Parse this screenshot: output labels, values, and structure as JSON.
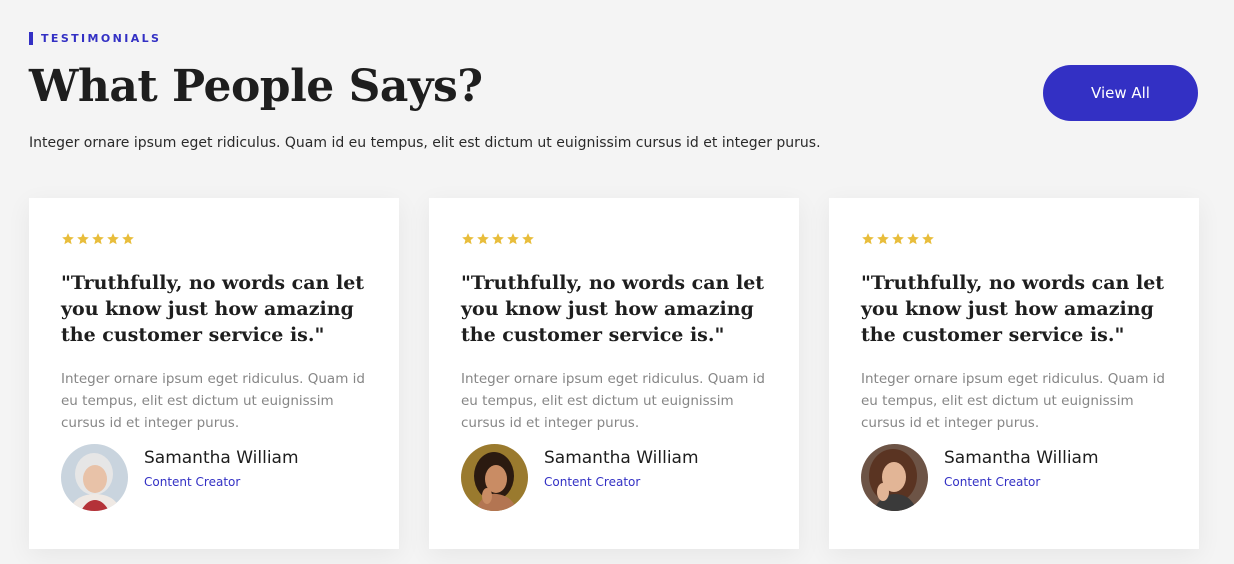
{
  "eyebrow": "TESTIMONIALS",
  "title": "What People Says?",
  "subtitle": "Integer ornare ipsum eget ridiculus. Quam id eu tempus, elit est dictum ut euignissim cursus id et integer purus.",
  "view_all_label": "View All",
  "colors": {
    "accent": "#3330c4",
    "star": "#e8bd3b",
    "background": "#f4f4f4",
    "card": "#ffffff"
  },
  "testimonials": [
    {
      "rating": 5,
      "rating_icon": "star-icon",
      "quote": "\"Truthfully, no words can let you know just how amazing the customer service is.\"",
      "text": "Integer ornare ipsum eget ridiculus. Quam id eu tempus, elit est dictum ut euignissim cursus id et integer purus.",
      "author": "Samantha William",
      "role": "Content Creator",
      "avatar_icon": "avatar-photo-elderly-woman"
    },
    {
      "rating": 5,
      "rating_icon": "star-icon",
      "quote": "\"Truthfully, no words can let you know just how amazing the customer service is.\"",
      "text": "Integer ornare ipsum eget ridiculus. Quam id eu tempus, elit est dictum ut euignissim cursus id et integer purus.",
      "author": "Samantha William",
      "role": "Content Creator",
      "avatar_icon": "avatar-photo-woman-dark-hair"
    },
    {
      "rating": 5,
      "rating_icon": "star-icon",
      "quote": "\"Truthfully, no words can let you know just how amazing the customer service is.\"",
      "text": "Integer ornare ipsum eget ridiculus. Quam id eu tempus, elit est dictum ut euignissim cursus id et integer purus.",
      "author": "Samantha William",
      "role": "Content Creator",
      "avatar_icon": "avatar-photo-woman-curly-hair"
    }
  ]
}
